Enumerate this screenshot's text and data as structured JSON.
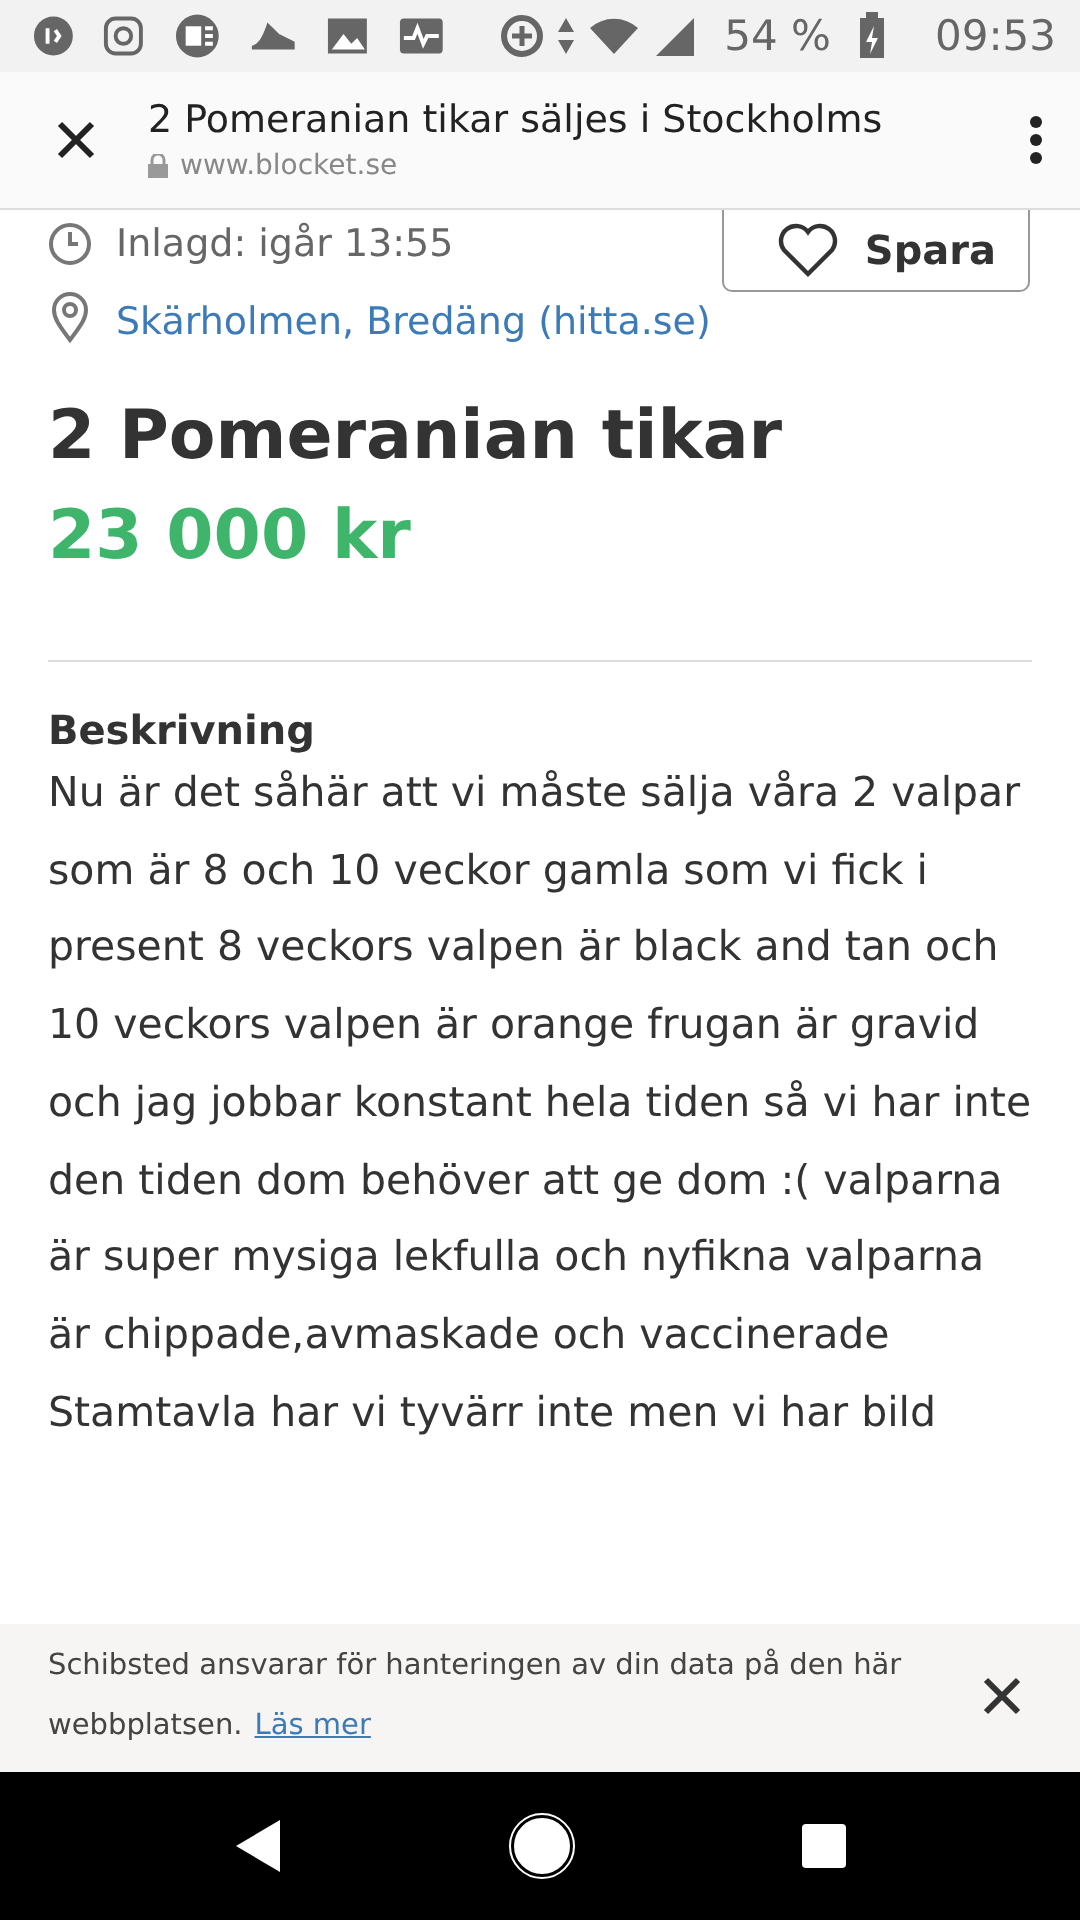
{
  "status_bar": {
    "battery": "54 %",
    "time": "09:53"
  },
  "toolbar": {
    "title": "2 Pomeranian tikar säljes i Stockholms",
    "url": "www.blocket.se"
  },
  "ad": {
    "posted": "Inlagd: igår 13:55",
    "save_button": "Spara",
    "location": "Skärholmen, Bredäng (hitta.se)",
    "title": "2 Pomeranian tikar",
    "price": "23 000 kr"
  },
  "description": {
    "heading": "Beskrivning",
    "paragraphs": [
      "Nu är det såhär att vi måste sälja våra 2 valpar som är 8 och 10 veckor gamla som vi fick i present 8 veckors valpen är black and tan och 10 veckors valpen är orange frugan är gravid och jag jobbar konstant hela tiden så vi har inte den tiden dom behöver att ge dom :( valparna är super mysiga lekfulla och nyfikna valparna är chippade,avmaskade och vaccinerade",
      "Stamtavla har vi tyvärr inte men vi har bild"
    ]
  },
  "consent_banner": {
    "text": "Schibsted ansvarar för hanteringen av din data på den här webbplatsen.",
    "link": "Läs mer"
  }
}
